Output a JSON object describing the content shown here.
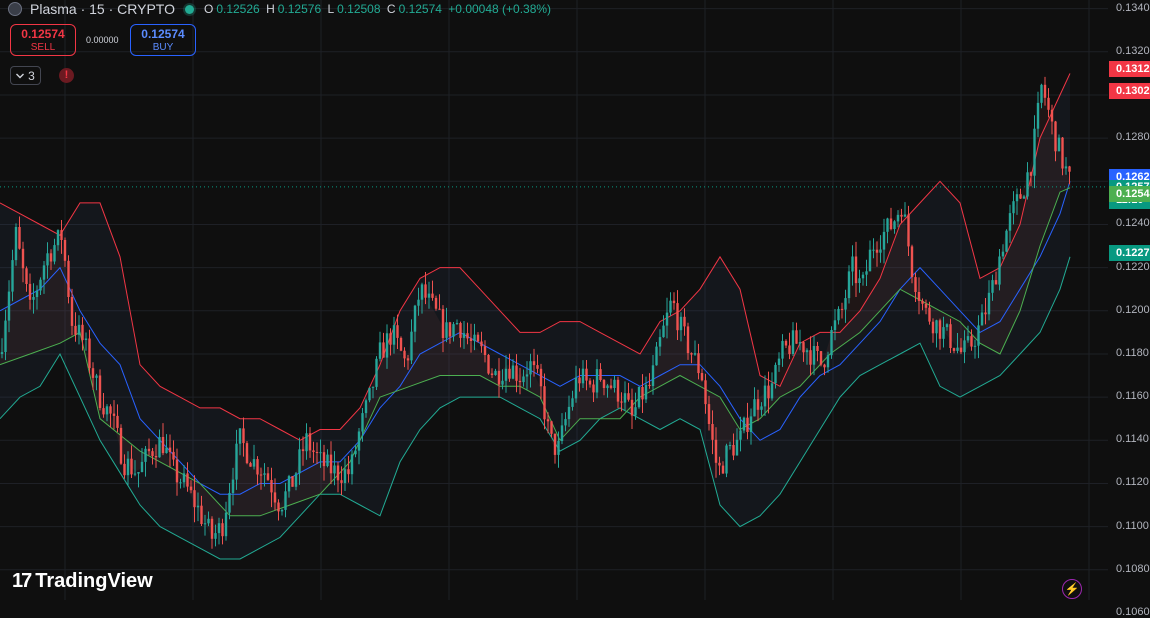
{
  "header": {
    "symbol_title": "Plasma · 15 · CRYPTO",
    "ohlc": {
      "open_key": "O",
      "open": "0.12526",
      "high_key": "H",
      "high": "0.12576",
      "low_key": "L",
      "low": "0.12508",
      "close_key": "C",
      "close": "0.12574",
      "change": "+0.00048 (+0.38%)"
    }
  },
  "trade": {
    "sell_price": "0.12574",
    "sell_label": "SELL",
    "spread": "0.00000",
    "buy_price": "0.12574",
    "buy_label": "BUY"
  },
  "indicators": {
    "collapsed_count": "3",
    "warning": "!"
  },
  "axis": {
    "ticks": [
      "0.1340",
      "0.1320",
      "0.1300",
      "0.1280",
      "0.1260",
      "0.1240",
      "0.1220",
      "0.1200",
      "0.1180",
      "0.1160",
      "0.1140",
      "0.1120",
      "0.1100",
      "0.1080",
      "0.1060"
    ],
    "price_labels": [
      {
        "text": "0.1312",
        "color": "#f23645",
        "value": 0.1312
      },
      {
        "text": "0.1302",
        "color": "#f23645",
        "value": 0.1302
      },
      {
        "text": "0.1262",
        "color": "#2962ff",
        "value": 0.1262
      },
      {
        "text": "0.1257",
        "sub": "11:10",
        "color": "#089981",
        "value": 0.1257
      },
      {
        "text": "0.1254",
        "color": "#4caf50",
        "value": 0.1254
      },
      {
        "text": "0.1227",
        "color": "#089981",
        "value": 0.1227
      }
    ]
  },
  "branding": {
    "logo_mark": "17",
    "logo_text": "TradingView",
    "bolt": "⚡"
  },
  "colors": {
    "up": "#26a69a",
    "down": "#ef5350",
    "upper_band": "#f23645",
    "middle_band": "#2962ff",
    "lower_band": "#22ab94",
    "trail_stop": "#4caf50",
    "last_price_line": "#089981"
  },
  "chart_data": {
    "type": "candlestick",
    "ylim": [
      0.1066,
      0.1344
    ],
    "last_price": 0.12574,
    "series": [
      {
        "name": "price",
        "x": [
          0,
          16,
          30,
          46,
          62,
          72,
          84,
          100,
          112,
          124,
          138,
          150,
          162,
          174,
          184,
          196,
          212,
          222,
          232,
          240,
          254,
          266,
          280,
          292,
          306,
          320,
          336,
          350,
          360,
          370,
          380,
          392,
          406,
          420,
          434,
          446,
          458,
          470,
          484,
          494,
          508,
          520,
          530,
          540,
          550,
          558,
          566,
          578,
          590,
          600,
          612,
          624,
          632,
          640,
          650,
          660,
          672,
          682,
          692,
          702,
          708,
          718,
          728,
          740,
          752,
          760,
          772,
          782,
          792,
          802,
          812,
          822,
          832,
          842,
          852,
          862,
          872,
          882,
          892,
          902,
          912,
          924,
          934,
          944,
          954,
          962,
          972,
          982,
          992,
          1002,
          1012,
          1022,
          1032,
          1042,
          1052,
          1062,
          1072
        ],
        "y": [
          0.118,
          0.1235,
          0.12,
          0.1225,
          0.1235,
          0.1195,
          0.1185,
          0.116,
          0.115,
          0.113,
          0.1125,
          0.1135,
          0.114,
          0.1125,
          0.112,
          0.111,
          0.1095,
          0.11,
          0.1125,
          0.114,
          0.113,
          0.1125,
          0.111,
          0.112,
          0.114,
          0.113,
          0.1125,
          0.1125,
          0.1145,
          0.116,
          0.118,
          0.119,
          0.1175,
          0.121,
          0.12,
          0.119,
          0.1195,
          0.1185,
          0.118,
          0.117,
          0.1175,
          0.117,
          0.1175,
          0.1165,
          0.114,
          0.1135,
          0.115,
          0.117,
          0.1165,
          0.117,
          0.1165,
          0.116,
          0.115,
          0.116,
          0.1165,
          0.1185,
          0.1205,
          0.119,
          0.118,
          0.117,
          0.115,
          0.1125,
          0.1135,
          0.114,
          0.1155,
          0.116,
          0.1165,
          0.118,
          0.1185,
          0.1185,
          0.118,
          0.1175,
          0.119,
          0.12,
          0.122,
          0.121,
          0.123,
          0.1235,
          0.124,
          0.125,
          0.122,
          0.12,
          0.1195,
          0.119,
          0.1185,
          0.118,
          0.1185,
          0.1195,
          0.121,
          0.123,
          0.1245,
          0.1255,
          0.127,
          0.1305,
          0.1285,
          0.127,
          0.1257
        ]
      },
      {
        "name": "upper",
        "x": [
          0,
          20,
          40,
          60,
          80,
          100,
          120,
          140,
          160,
          180,
          200,
          220,
          240,
          260,
          280,
          300,
          320,
          340,
          360,
          380,
          400,
          420,
          440,
          460,
          480,
          500,
          520,
          540,
          560,
          580,
          600,
          620,
          640,
          660,
          680,
          700,
          720,
          740,
          760,
          780,
          800,
          820,
          840,
          860,
          880,
          900,
          920,
          940,
          960,
          980,
          1000,
          1020,
          1040,
          1060,
          1070
        ],
        "y": [
          0.125,
          0.1245,
          0.124,
          0.1235,
          0.125,
          0.125,
          0.1225,
          0.1175,
          0.1165,
          0.116,
          0.1155,
          0.1155,
          0.115,
          0.115,
          0.1145,
          0.114,
          0.1145,
          0.1145,
          0.1155,
          0.1175,
          0.12,
          0.1215,
          0.122,
          0.122,
          0.121,
          0.12,
          0.119,
          0.119,
          0.1195,
          0.1195,
          0.119,
          0.1185,
          0.118,
          0.1195,
          0.12,
          0.121,
          0.1225,
          0.121,
          0.117,
          0.1165,
          0.1185,
          0.119,
          0.119,
          0.12,
          0.1215,
          0.124,
          0.125,
          0.126,
          0.125,
          0.1215,
          0.122,
          0.124,
          0.128,
          0.13,
          0.131
        ]
      },
      {
        "name": "middle",
        "x": [
          0,
          20,
          40,
          60,
          80,
          100,
          120,
          140,
          160,
          180,
          200,
          220,
          240,
          260,
          280,
          300,
          320,
          340,
          360,
          380,
          400,
          420,
          440,
          460,
          480,
          500,
          520,
          540,
          560,
          580,
          600,
          620,
          640,
          660,
          680,
          700,
          720,
          740,
          760,
          780,
          800,
          820,
          840,
          860,
          880,
          900,
          920,
          940,
          960,
          980,
          1000,
          1020,
          1040,
          1060,
          1070
        ],
        "y": [
          0.12,
          0.1205,
          0.121,
          0.122,
          0.12,
          0.1185,
          0.1175,
          0.115,
          0.114,
          0.113,
          0.112,
          0.1115,
          0.1115,
          0.112,
          0.112,
          0.1125,
          0.113,
          0.113,
          0.114,
          0.1155,
          0.1165,
          0.118,
          0.1185,
          0.119,
          0.1185,
          0.118,
          0.1175,
          0.117,
          0.1165,
          0.117,
          0.117,
          0.117,
          0.1165,
          0.117,
          0.1175,
          0.1175,
          0.1165,
          0.115,
          0.114,
          0.1145,
          0.116,
          0.117,
          0.1175,
          0.1185,
          0.1195,
          0.121,
          0.122,
          0.121,
          0.12,
          0.119,
          0.1195,
          0.121,
          0.1225,
          0.1245,
          0.126
        ]
      },
      {
        "name": "lower",
        "x": [
          0,
          20,
          40,
          60,
          80,
          100,
          120,
          140,
          160,
          180,
          200,
          220,
          240,
          260,
          280,
          300,
          320,
          340,
          360,
          380,
          400,
          420,
          440,
          460,
          480,
          500,
          520,
          540,
          560,
          580,
          600,
          620,
          640,
          660,
          680,
          700,
          720,
          740,
          760,
          780,
          800,
          820,
          840,
          860,
          880,
          900,
          920,
          940,
          960,
          980,
          1000,
          1020,
          1040,
          1060,
          1070
        ],
        "y": [
          0.115,
          0.116,
          0.1165,
          0.118,
          0.116,
          0.114,
          0.1125,
          0.111,
          0.11,
          0.1095,
          0.109,
          0.1085,
          0.1085,
          0.109,
          0.1095,
          0.1105,
          0.1115,
          0.1115,
          0.111,
          0.1105,
          0.113,
          0.1145,
          0.1155,
          0.116,
          0.116,
          0.116,
          0.1155,
          0.115,
          0.1135,
          0.114,
          0.115,
          0.1155,
          0.115,
          0.1145,
          0.115,
          0.1145,
          0.111,
          0.11,
          0.1105,
          0.1115,
          0.113,
          0.1145,
          0.116,
          0.117,
          0.1175,
          0.118,
          0.1185,
          0.1165,
          0.116,
          0.1165,
          0.117,
          0.118,
          0.119,
          0.121,
          0.1225
        ]
      },
      {
        "name": "trail",
        "x": [
          0,
          30,
          60,
          80,
          100,
          140,
          180,
          200,
          230,
          260,
          290,
          320,
          350,
          380,
          410,
          440,
          460,
          480,
          500,
          520,
          540,
          560,
          580,
          600,
          620,
          640,
          660,
          680,
          700,
          720,
          740,
          760,
          780,
          800,
          830,
          860,
          880,
          900,
          920,
          940,
          960,
          980,
          1000,
          1020,
          1040,
          1060,
          1070
        ],
        "y": [
          0.1175,
          0.118,
          0.1185,
          0.119,
          0.115,
          0.1135,
          0.1125,
          0.112,
          0.1105,
          0.1105,
          0.111,
          0.1115,
          0.113,
          0.116,
          0.1165,
          0.117,
          0.117,
          0.117,
          0.1165,
          0.1165,
          0.116,
          0.114,
          0.115,
          0.115,
          0.115,
          0.116,
          0.1165,
          0.117,
          0.1165,
          0.116,
          0.1145,
          0.115,
          0.116,
          0.1165,
          0.118,
          0.119,
          0.12,
          0.121,
          0.1205,
          0.12,
          0.1195,
          0.1185,
          0.118,
          0.12,
          0.123,
          0.1255,
          0.1257
        ]
      }
    ]
  }
}
